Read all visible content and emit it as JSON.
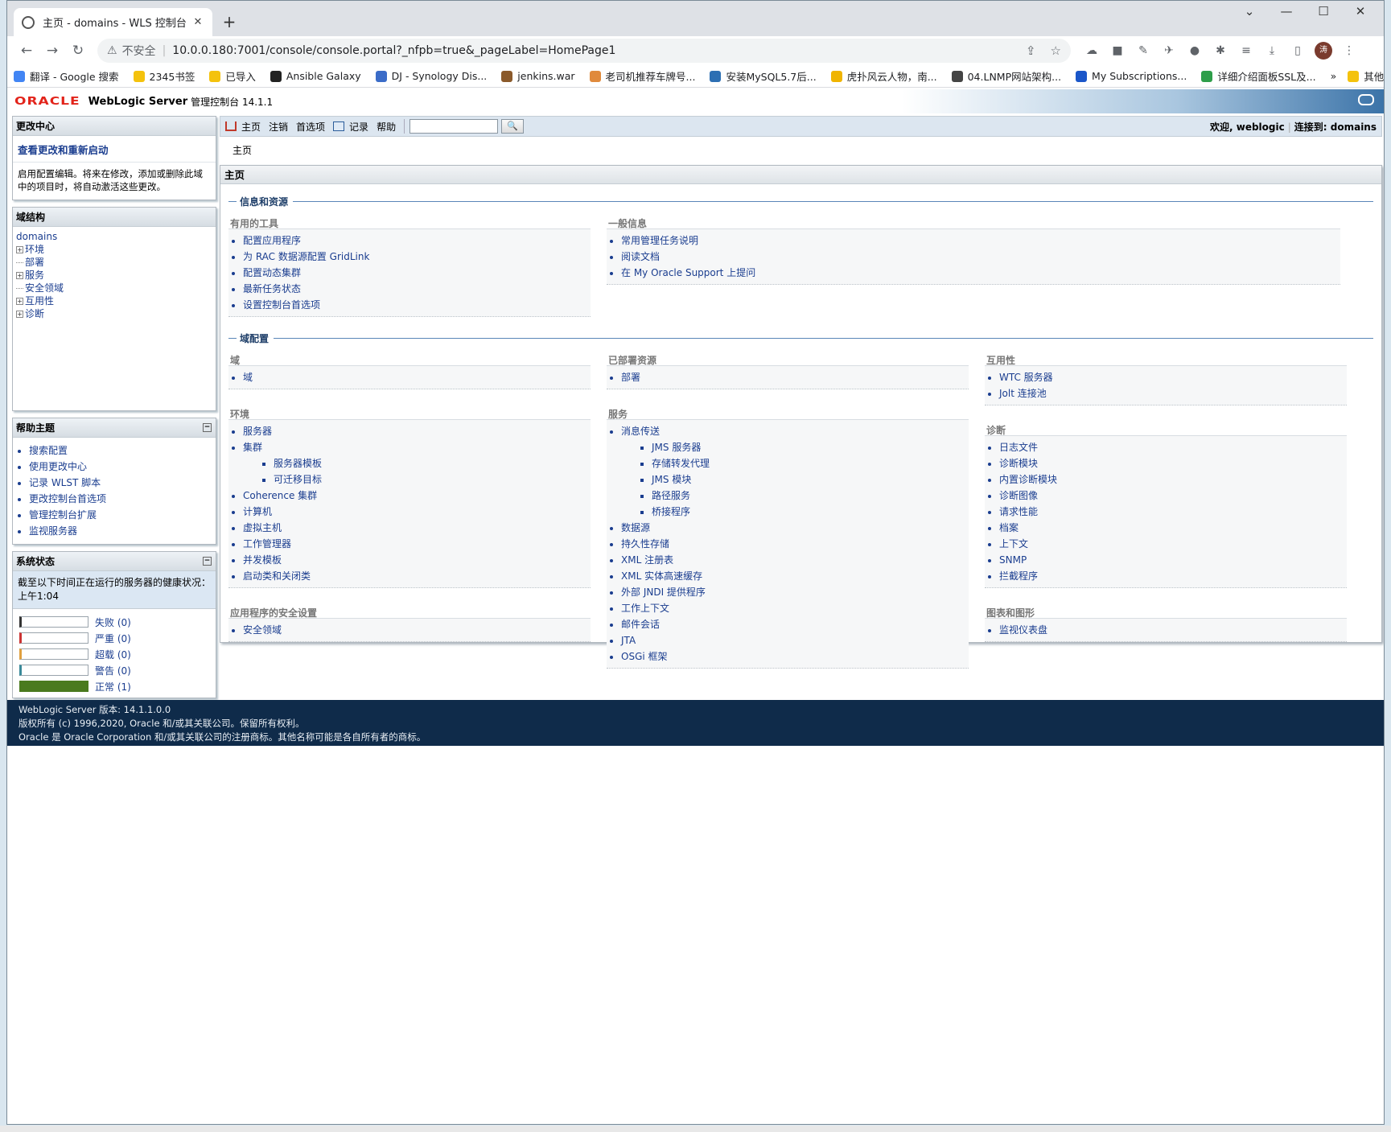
{
  "browser": {
    "tab_title": "主页 - domains - WLS 控制台",
    "tab_close": "✕",
    "new_tab": "+",
    "security_label": "不安全",
    "url": "10.0.0.180:7001/console/console.portal?_nfpb=true&_pageLabel=HomePage1",
    "avatar_text": "涛",
    "bookmarks": [
      "翻译 - Google 搜索",
      "2345书签",
      "已导入",
      "Ansible Galaxy",
      "DJ - Synology Dis...",
      "jenkins.war",
      "老司机推荐车牌号...",
      "安装MySQL5.7后...",
      "虎扑风云人物，南...",
      "04.LNMP网站架构...",
      "My Subscriptions...",
      "详细介绍面板SSL及..."
    ],
    "bookmarks_more": "»",
    "other_bookmarks": "其他书签"
  },
  "header": {
    "logo": "ORACLE",
    "product": "WebLogic Server",
    "subtitle": "管理控制台 14.1.1"
  },
  "left": {
    "change_center": {
      "title": "更改中心",
      "link": "查看更改和重新启动",
      "text": "启用配置编辑。将来在修改，添加或删除此域中的项目时，将自动激活这些更改。"
    },
    "domain_structure": {
      "title": "域结构",
      "root": "domains",
      "nodes": [
        {
          "label": "环境",
          "expandable": true
        },
        {
          "label": "部署",
          "expandable": false
        },
        {
          "label": "服务",
          "expandable": true
        },
        {
          "label": "安全领域",
          "expandable": false
        },
        {
          "label": "互用性",
          "expandable": true
        },
        {
          "label": "诊断",
          "expandable": true
        }
      ]
    },
    "help": {
      "title": "帮助主题",
      "items": [
        "搜索配置",
        "使用更改中心",
        "记录 WLST 脚本",
        "更改控制台首选项",
        "管理控制台扩展",
        "监视服务器"
      ]
    },
    "system_status": {
      "title": "系统状态",
      "note": "截至以下时间正在运行的服务器的健康状况：上午1:04",
      "rows": [
        {
          "label": "失败 (0)",
          "color": "#333333",
          "fill": 0
        },
        {
          "label": "严重 (0)",
          "color": "#cc3333",
          "fill": 0
        },
        {
          "label": "超载 (0)",
          "color": "#e0a040",
          "fill": 0
        },
        {
          "label": "警告 (0)",
          "color": "#3a8a9a",
          "fill": 0
        },
        {
          "label": "正常 (1)",
          "color": "#4a7a1e",
          "fill": 1
        }
      ]
    }
  },
  "nav": {
    "home": "主页",
    "logout": "注销",
    "prefs": "首选项",
    "record": "记录",
    "help": "帮助",
    "welcome": "欢迎, weblogic",
    "connected": "连接到: domains",
    "breadcrumb": "主页"
  },
  "content": {
    "panel_title": "主页",
    "section1": "信息和资源",
    "section2": "域配置",
    "tools": {
      "title": "有用的工具",
      "items": [
        "配置应用程序",
        "为 RAC 数据源配置 GridLink",
        "配置动态集群",
        "最新任务状态",
        "设置控制台首选项"
      ]
    },
    "general": {
      "title": "一般信息",
      "items": [
        "常用管理任务说明",
        "阅读文档",
        "在 My Oracle Support 上提问"
      ]
    },
    "domain": {
      "title": "域",
      "items": [
        "域"
      ]
    },
    "environment": {
      "title": "环境",
      "servers": "服务器",
      "clusters": "集群",
      "cluster_children": [
        "服务器模板",
        "可迁移目标"
      ],
      "items": [
        "Coherence 集群",
        "计算机",
        "虚拟主机",
        "工作管理器",
        "并发模板",
        "启动类和关闭类"
      ]
    },
    "app_security": {
      "title": "应用程序的安全设置",
      "items": [
        "安全领域"
      ]
    },
    "deployed": {
      "title": "已部署资源",
      "items": [
        "部署"
      ]
    },
    "services": {
      "title": "服务",
      "messaging": "消息传送",
      "messaging_children": [
        "JMS 服务器",
        "存储转发代理",
        "JMS 模块",
        "路径服务",
        "桥接程序"
      ],
      "items": [
        "数据源",
        "持久性存储",
        "XML 注册表",
        "XML 实体高速缓存",
        "外部 JNDI 提供程序",
        "工作上下文",
        "邮件会话",
        "JTA",
        "OSGi 框架"
      ]
    },
    "interop": {
      "title": "互用性",
      "items": [
        "WTC 服务器",
        "Jolt 连接池"
      ]
    },
    "diagnostics": {
      "title": "诊断",
      "items": [
        "日志文件",
        "诊断模块",
        "内置诊断模块",
        "诊断图像",
        "请求性能",
        "档案",
        "上下文",
        "SNMP",
        "拦截程序"
      ]
    },
    "charts": {
      "title": "图表和图形",
      "items": [
        "监视仪表盘"
      ]
    }
  },
  "footer": {
    "line1": "WebLogic Server 版本: 14.1.1.0.0",
    "line2": "版权所有 (c) 1996,2020, Oracle 和/或其关联公司。保留所有权利。",
    "line3": "Oracle 是 Oracle Corporation 和/或其关联公司的注册商标。其他名称可能是各自所有者的商标。"
  }
}
